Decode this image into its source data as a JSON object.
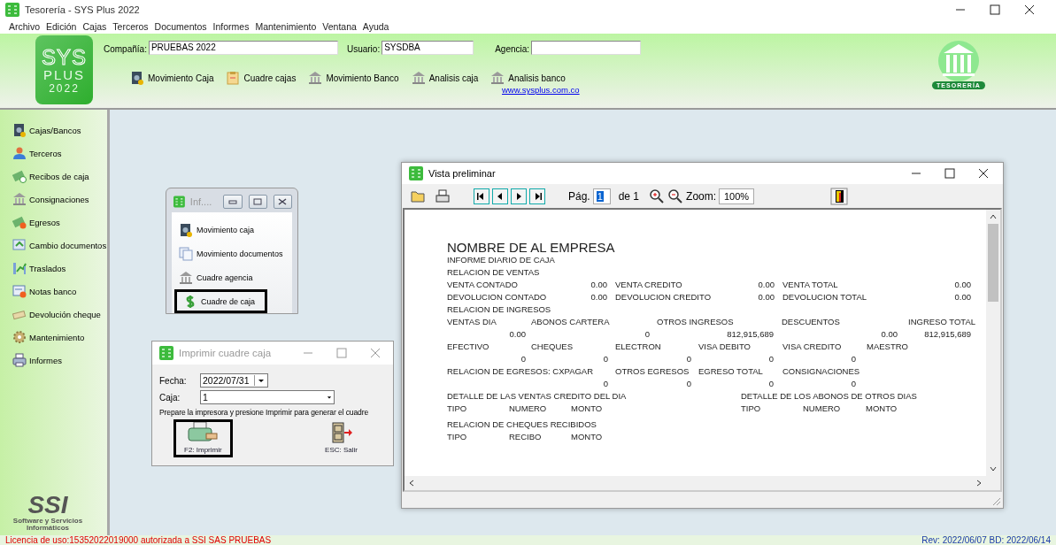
{
  "window": {
    "title": "Tesorería - SYS Plus 2022"
  },
  "menu": [
    "Archivo",
    "Edición",
    "Cajas",
    "Terceros",
    "Documentos",
    "Informes",
    "Mantenimiento",
    "Ventana",
    "Ayuda"
  ],
  "header": {
    "logo": {
      "brand": "SYS",
      "product": "PLUS",
      "year": "2022"
    },
    "fields": [
      {
        "label": "Compañía:",
        "value": "PRUEBAS 2022"
      },
      {
        "label": "Usuario:",
        "value": "SYSDBA"
      },
      {
        "label": "Agencia:"
      }
    ],
    "shortcuts": [
      "Movimiento Caja",
      "Cuadre cajas",
      "Movimiento Banco",
      "Analisis caja",
      "Analisis banco"
    ],
    "link": "www.sysplus.com.co",
    "module_badge": "TESORERÍA"
  },
  "sidebar": {
    "items": [
      "Cajas/Bancos",
      "Terceros",
      "Recibos de caja",
      "Consignaciones",
      "Egresos",
      "Cambio documentos",
      "Traslados",
      "Notas banco",
      "Devolución cheque",
      "Mantenimiento",
      "Informes"
    ],
    "footer_logo": "SSI",
    "footer": "Software y Servicios Informáticos"
  },
  "info_window": {
    "title": "Inf....",
    "items": [
      {
        "label": "Movimiento caja",
        "highlighted": false
      },
      {
        "label": "Movimiento documentos",
        "highlighted": false
      },
      {
        "label": "Cuadre agencia",
        "highlighted": false
      },
      {
        "label": "Cuadre de caja",
        "highlighted": true
      }
    ]
  },
  "print_dialog": {
    "title": "Imprimir cuadre caja",
    "fields": [
      {
        "label": "Fecha:",
        "value": "2022/07/31"
      },
      {
        "label": "Caja:",
        "value": "1"
      }
    ],
    "hint": "Prepare la impresora y presione Imprimir para generar el cuadre",
    "buttons": [
      {
        "label": "F2: Imprimir",
        "highlighted": true
      },
      {
        "label": "ESC: Salir",
        "highlighted": false
      }
    ]
  },
  "preview": {
    "title": "Vista preliminar",
    "page_label": "Pág.",
    "page": "1",
    "page_total": "de 1",
    "zoom_label": "Zoom:",
    "zoom": "100%",
    "report": [
      {
        "kind": "title",
        "cells": [
          "NOMBRE DE AL EMPRESA"
        ]
      },
      {
        "kind": "line",
        "cells": [
          "INFORME DIARIO DE CAJA"
        ]
      },
      {
        "kind": "line",
        "cells": [
          "RELACION DE VENTAS"
        ]
      },
      {
        "kind": "totals",
        "cells": [
          "VENTA CONTADO",
          "0.00",
          "VENTA CREDITO",
          "0.00",
          "VENTA TOTAL",
          "0.00"
        ]
      },
      {
        "kind": "totals",
        "cells": [
          "DEVOLUCION CONTADO",
          "0.00",
          "DEVOLUCION CREDITO",
          "0.00",
          "DEVOLUCION TOTAL",
          "0.00"
        ]
      },
      {
        "kind": "line",
        "cells": [
          "RELACION DE INGRESOS"
        ]
      },
      {
        "kind": "income-head",
        "cells": [
          "VENTAS DIA",
          "ABONOS CARTERA",
          "OTROS INGRESOS",
          "DESCUENTOS",
          "INGRESO TOTAL"
        ]
      },
      {
        "kind": "income-values",
        "cells": [
          "0.00",
          "0",
          "812,915,689",
          "0.00",
          "812,915,689"
        ]
      },
      {
        "kind": "payment-head",
        "cells": [
          "EFECTIVO",
          "CHEQUES",
          "ELECTRON",
          "VISA DEBITO",
          "VISA CREDITO",
          "MAESTRO"
        ]
      },
      {
        "kind": "payment-values",
        "cells": [
          "0",
          "0",
          "0",
          "0",
          "0"
        ]
      },
      {
        "kind": "expense-head",
        "cells": [
          "RELACION DE EGRESOS: CXPAGAR",
          "OTROS EGRESOS",
          "EGRESO TOTAL",
          "CONSIGNACIONES"
        ]
      },
      {
        "kind": "expense-values",
        "cells": [
          "0",
          "0",
          "0",
          "0"
        ]
      },
      {
        "kind": "detail-head",
        "cells": [
          "DETALLE DE LAS VENTAS CREDITO DEL DIA",
          "DETALLE DE LOS ABONOS DE OTROS DIAS"
        ]
      },
      {
        "kind": "detail-columns",
        "cells": [
          "TIPO",
          "NUMERO",
          "MONTO",
          "TIPO",
          "NUMERO",
          "MONTO"
        ]
      },
      {
        "kind": "section",
        "cells": [
          "RELACION DE CHEQUES RECIBIDOS"
        ]
      },
      {
        "kind": "detail-columns",
        "cells": [
          "TIPO",
          "RECIBO",
          "MONTO"
        ]
      }
    ]
  },
  "status_bar": {
    "license": "Licencia de uso:15352022019000 autorizada a SSI SAS PRUEBAS",
    "revision": "Rev: 2022/06/07 BD: 2022/06/14"
  }
}
